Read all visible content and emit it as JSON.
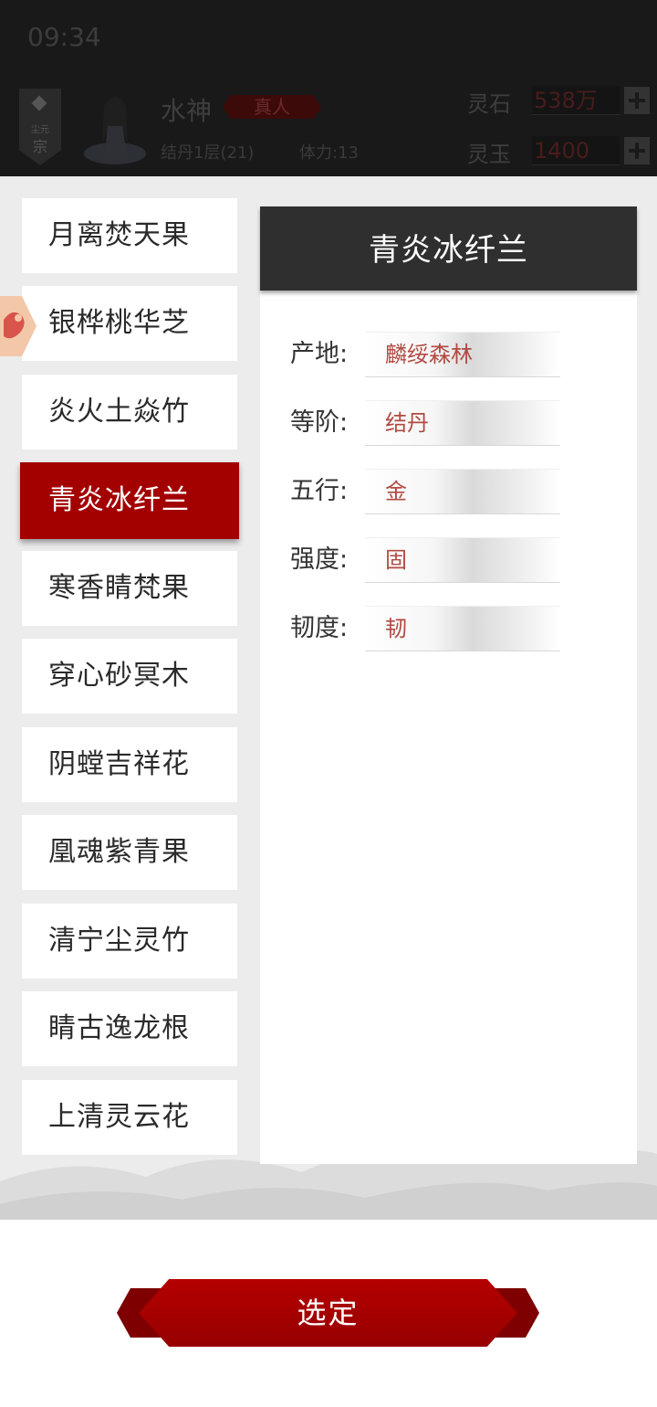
{
  "status_bar": {
    "time": "09:34"
  },
  "player": {
    "sect_badge": {
      "small_text": "尘元",
      "big_text": "宗"
    },
    "name": "水神",
    "rank": "真人",
    "realm": "结丹1层(21)",
    "stamina": "体力:13"
  },
  "currencies": [
    {
      "label": "灵石",
      "value": "538万"
    },
    {
      "label": "灵玉",
      "value": "1400"
    }
  ],
  "herb_list": [
    {
      "name": "月离焚天果",
      "selected": false
    },
    {
      "name": "银桦桃华芝",
      "selected": false
    },
    {
      "name": "炎火土焱竹",
      "selected": false
    },
    {
      "name": "青炎冰纤兰",
      "selected": true
    },
    {
      "name": "寒香睛梵果",
      "selected": false
    },
    {
      "name": "穿心砂冥木",
      "selected": false
    },
    {
      "name": "阴螳吉祥花",
      "selected": false
    },
    {
      "name": "凰魂紫青果",
      "selected": false
    },
    {
      "name": "清宁尘灵竹",
      "selected": false
    },
    {
      "name": "睛古逸龙根",
      "selected": false
    },
    {
      "name": "上清灵云花",
      "selected": false
    }
  ],
  "detail": {
    "title": "青炎冰纤兰",
    "attributes": [
      {
        "label": "产地:",
        "value": "麟绥森林"
      },
      {
        "label": "等阶:",
        "value": "结丹"
      },
      {
        "label": "五行:",
        "value": "金"
      },
      {
        "label": "强度:",
        "value": "固"
      },
      {
        "label": "韧度:",
        "value": "韧"
      }
    ]
  },
  "confirm_button": {
    "label": "选定"
  },
  "colors": {
    "accent_red": "#a30000",
    "value_red": "#b04a42",
    "title_bar": "#2f2f2f",
    "panel_bg": "#ececec"
  }
}
